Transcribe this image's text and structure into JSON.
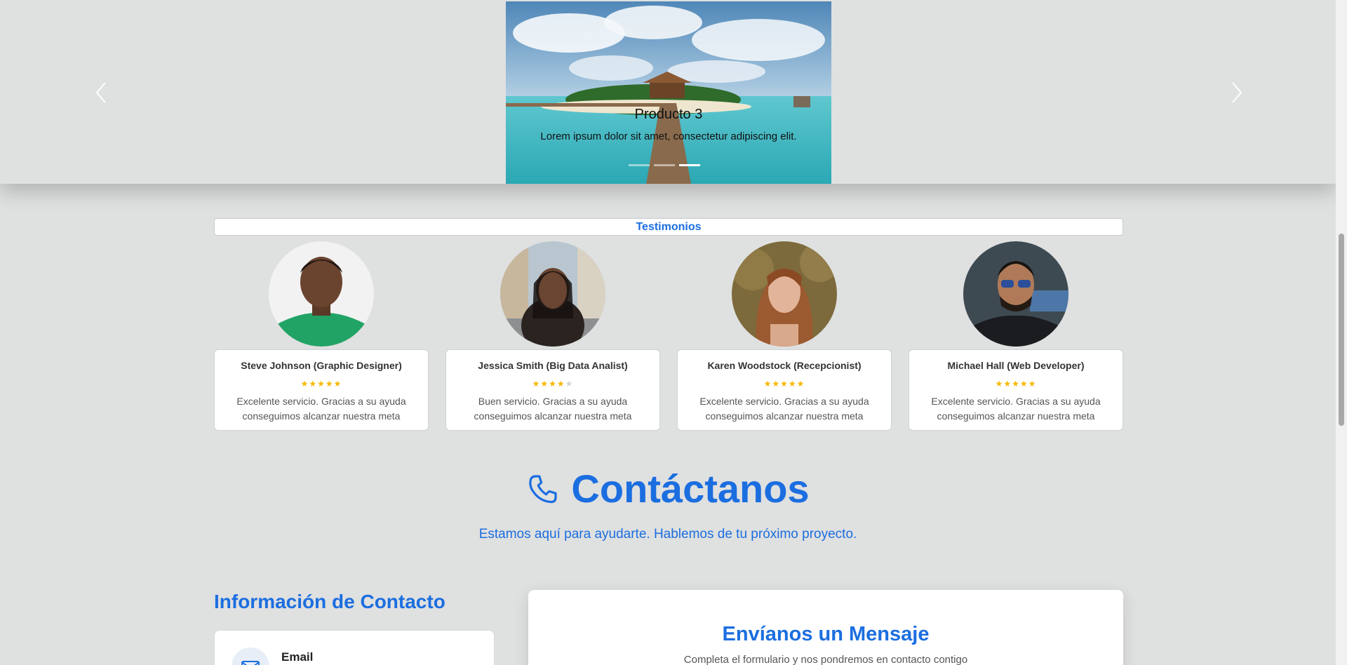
{
  "carousel": {
    "slide_title": "Producto 3",
    "slide_text": "Lorem ipsum dolor sit amet, consectetur adipiscing elit.",
    "indicator_count": 3,
    "active_indicator": 3
  },
  "testimonials": {
    "header": "Testimonios",
    "items": [
      {
        "name": "Steve Johnson (Graphic Designer)",
        "rating": 5,
        "text": "Excelente servicio. Gracias a su ayuda conseguimos alcanzar nuestra meta"
      },
      {
        "name": "Jessica Smith (Big Data Analist)",
        "rating": 4,
        "text": "Buen servicio. Gracias a su ayuda conseguimos alcanzar nuestra meta"
      },
      {
        "name": "Karen Woodstock (Recepcionist)",
        "rating": 5,
        "text": "Excelente servicio. Gracias a su ayuda conseguimos alcanzar nuestra meta"
      },
      {
        "name": "Michael Hall (Web Developer)",
        "rating": 5,
        "text": "Excelente servicio. Gracias a su ayuda conseguimos alcanzar nuestra meta"
      }
    ]
  },
  "contact": {
    "title": "Contáctanos",
    "title_icon": "phone-icon",
    "subtitle": "Estamos aquí para ayudarte. Hablemos de tu próximo proyecto.",
    "info_title": "Información de Contacto",
    "email_label": "Email",
    "email_icon": "mail-icon",
    "form_title": "Envíanos un Mensaje",
    "form_subtitle": "Completa el formulario y nos pondremos en contacto contigo"
  },
  "colors": {
    "accent": "#1b6ee0",
    "page_bg": "#dfe0e0",
    "star": "#f5b800"
  }
}
